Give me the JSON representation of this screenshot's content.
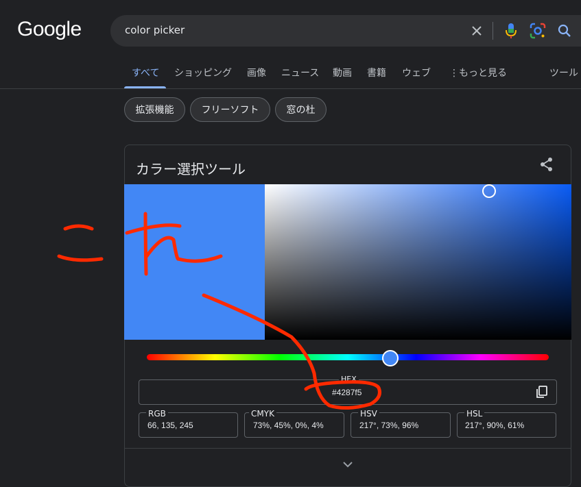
{
  "header": {
    "logo_text": "Google",
    "search_query": "color picker"
  },
  "tabs": [
    {
      "label": "すべて",
      "active": true
    },
    {
      "label": "ショッピング"
    },
    {
      "label": "画像"
    },
    {
      "label": "ニュース"
    },
    {
      "label": "動画"
    },
    {
      "label": "書籍"
    },
    {
      "label": "ウェブ"
    },
    {
      "label": "もっと見る"
    },
    {
      "label": "ツール"
    }
  ],
  "chips": [
    "拡張機能",
    "フリーソフト",
    "窓の杜"
  ],
  "picker": {
    "title": "カラー選択ツール",
    "hex_label": "HEX",
    "hex_value": "#4287f5",
    "selected_color": "#4287f5",
    "hue_level_percent": 60,
    "fields": [
      {
        "label": "RGB",
        "value": "66, 135, 245"
      },
      {
        "label": "CMYK",
        "value": "73%, 45%, 0%, 4%"
      },
      {
        "label": "HSV",
        "value": "217°, 73%, 96%"
      },
      {
        "label": "HSL",
        "value": "217°, 90%, 61%"
      }
    ]
  },
  "colors": {
    "background": "#202124",
    "accent": "#8ab4f8",
    "annotation": "#ff2a00"
  }
}
